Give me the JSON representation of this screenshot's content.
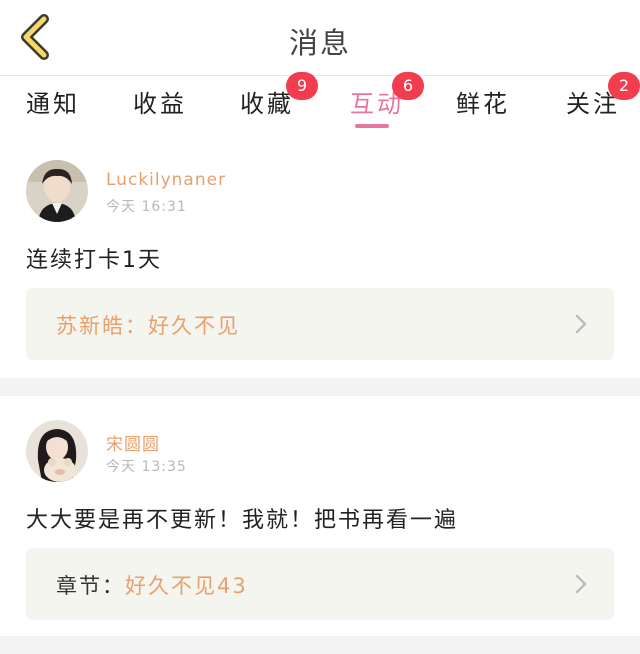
{
  "header": {
    "title": "消息"
  },
  "tabs": [
    {
      "label": "通知",
      "badge": null,
      "active": false
    },
    {
      "label": "收益",
      "badge": null,
      "active": false
    },
    {
      "label": "收藏",
      "badge": "9",
      "active": false
    },
    {
      "label": "互动",
      "badge": "6",
      "active": true
    },
    {
      "label": "鲜花",
      "badge": null,
      "active": false
    },
    {
      "label": "关注",
      "badge": "2",
      "active": false
    }
  ],
  "posts": [
    {
      "username": "Luckilynaner",
      "time": "今天  16:31",
      "content": "连续打卡1天",
      "reply": {
        "user": "苏新皓",
        "sep": "：",
        "message": "好久不见"
      }
    },
    {
      "username": "宋圆圆",
      "time": "今天  13:35",
      "content": "大大要是再不更新！我就！把书再看一遍",
      "reply": {
        "user": "章节",
        "sep": "：",
        "message": "好久不见43"
      }
    }
  ],
  "colors": {
    "accent": "#e8769a",
    "badge": "#f23d4f",
    "username": "#e8a06d",
    "reply_bg": "#f5f5ef"
  }
}
